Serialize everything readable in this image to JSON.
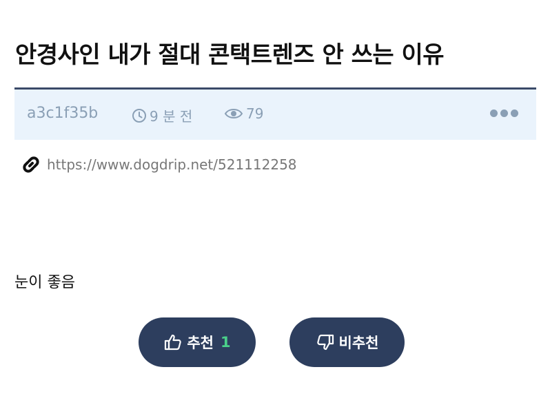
{
  "post": {
    "title": "안경사인 내가 절대 콘택트렌즈 안 쓰는 이유",
    "author": "a3c1f35b",
    "time": "9 분 전",
    "views": "79",
    "link": "https://www.dogdrip.net/521112258",
    "body": "눈이 좋음"
  },
  "actions": {
    "upvote_label": "추천",
    "upvote_count": "1",
    "downvote_label": "비추천"
  },
  "icons": {
    "clock": "clock-icon",
    "eye": "eye-icon",
    "more": "more-dots-icon",
    "link": "link-icon",
    "thumbs_up": "thumbs-up-icon",
    "thumbs_down": "thumbs-down-icon"
  },
  "colors": {
    "accent": "#2d3e5e",
    "meta_bg": "#eaf3fc",
    "meta_text": "#8a9fb5",
    "count": "#4ad08a"
  }
}
